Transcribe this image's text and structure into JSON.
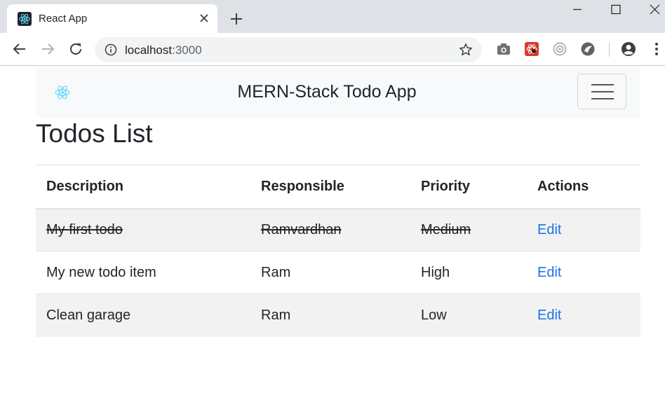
{
  "browser": {
    "tab_title": "React App",
    "url_host": "localhost",
    "url_port": ":3000",
    "icons": [
      "react-favicon",
      "close-icon",
      "plus-icon",
      "minimize-icon",
      "maximize-icon",
      "window-close-icon",
      "back-arrow-icon",
      "forward-arrow-icon",
      "reload-icon",
      "info-icon",
      "star-icon",
      "camera-icon",
      "extension-icon",
      "extension-icon",
      "extension-icon",
      "account-icon",
      "menu-dots-icon"
    ]
  },
  "navbar": {
    "brand": "MERN-Stack Todo App",
    "accent": "#61dafb"
  },
  "page": {
    "title": "Todos List",
    "columns": [
      "Description",
      "Responsible",
      "Priority",
      "Actions"
    ],
    "rows": [
      {
        "description": "My first todo",
        "responsible": "Ramvardhan",
        "priority": "Medium",
        "action": "Edit",
        "completed": true
      },
      {
        "description": "My new todo item",
        "responsible": "Ram",
        "priority": "High",
        "action": "Edit",
        "completed": false
      },
      {
        "description": "Clean garage",
        "responsible": "Ram",
        "priority": "Low",
        "action": "Edit",
        "completed": false
      }
    ],
    "link_color": "#1a73e8"
  }
}
